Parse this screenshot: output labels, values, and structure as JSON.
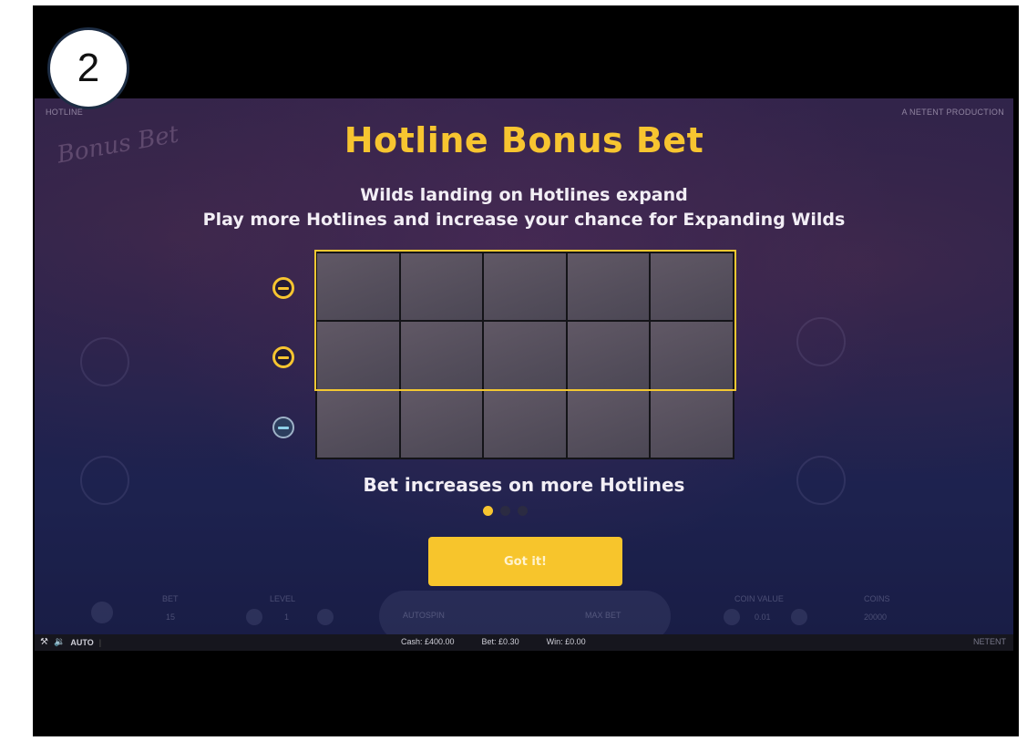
{
  "step_badge": "2",
  "header": {
    "game_name": "HOTLINE",
    "production": "A NETENT PRODUCTION",
    "logo_script": "Bonus Bet"
  },
  "dialog": {
    "title": "Hotline Bonus Bet",
    "subtitle_1": "Wilds landing on Hotlines expand",
    "subtitle_2": "Play more Hotlines and increase your chance for Expanding Wilds",
    "caption": "Bet increases on more Hotlines",
    "button_label": "Got it!",
    "pages_total": 3,
    "page_active": 1,
    "grid": {
      "rows": 3,
      "cols": 5,
      "hotlines_active": 2
    }
  },
  "controls_ghost": {
    "bet_label": "BET",
    "bet_value": "15",
    "level_label": "LEVEL",
    "level_value": "1",
    "autospin_label": "AUTOSPIN",
    "maxbet_label": "MAX BET",
    "coin_value_label": "COIN VALUE",
    "coin_value": "0.01",
    "coins_label": "COINS",
    "coins_value": "20000"
  },
  "status_bar": {
    "auto_label": "AUTO",
    "cash": "Cash: £400.00",
    "bet": "Bet: £0.30",
    "win": "Win: £0.00",
    "brand": "NETENT"
  },
  "colors": {
    "accent": "#f7c530",
    "text": "#f2eef5",
    "background": "#2b2a5c"
  }
}
